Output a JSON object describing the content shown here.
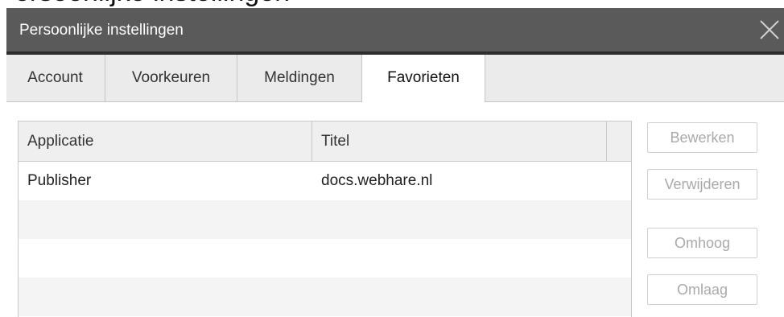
{
  "page_title_partial": "ersoonlijke instellingen",
  "dialog": {
    "title": "Persoonlijke instellingen",
    "close_icon": "close-icon"
  },
  "tabs": [
    {
      "label": "Account",
      "active": false
    },
    {
      "label": "Voorkeuren",
      "active": false
    },
    {
      "label": "Meldingen",
      "active": false
    },
    {
      "label": "Favorieten",
      "active": true
    }
  ],
  "favorites_list": {
    "columns": [
      "Applicatie",
      "Titel"
    ],
    "rows": [
      {
        "applicatie": "Publisher",
        "titel": "docs.webhare.nl"
      }
    ]
  },
  "buttons": {
    "edit": "Bewerken",
    "delete": "Verwijderen",
    "up": "Omhoog",
    "down": "Omlaag"
  },
  "colors": {
    "titlebar": "#5a5a5a",
    "titlebar_border": "#2e2e2e",
    "tabbar": "#ebebeb",
    "disabled_text": "#a9a9a9"
  }
}
